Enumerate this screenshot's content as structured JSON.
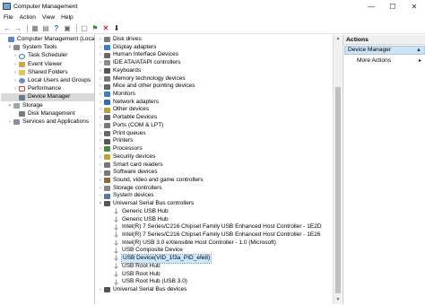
{
  "window": {
    "title": "Computer Management",
    "controls": [
      "—",
      "☐",
      "✕"
    ]
  },
  "menu": [
    "File",
    "Action",
    "View",
    "Help"
  ],
  "toolbar": [
    "←",
    "→",
    "▦",
    "▤",
    "?",
    "▣",
    "▢",
    "⚑",
    "✕",
    "⬇"
  ],
  "left_tree": [
    {
      "label": "Computer Management (Local",
      "indent": 0,
      "exp": "",
      "icon": "mgmt",
      "selected": false
    },
    {
      "label": "System Tools",
      "indent": 1,
      "exp": "˅",
      "icon": "tools",
      "selected": false
    },
    {
      "label": "Task Scheduler",
      "indent": 2,
      "exp": "›",
      "icon": "clock",
      "selected": false
    },
    {
      "label": "Event Viewer",
      "indent": 2,
      "exp": "›",
      "icon": "ev",
      "selected": false
    },
    {
      "label": "Shared Folders",
      "indent": 2,
      "exp": "›",
      "icon": "fold",
      "selected": false
    },
    {
      "label": "Local Users and Groups",
      "indent": 2,
      "exp": "›",
      "icon": "users",
      "selected": false
    },
    {
      "label": "Performance",
      "indent": 2,
      "exp": "›",
      "icon": "perf",
      "selected": false
    },
    {
      "label": "Device Manager",
      "indent": 2,
      "exp": "",
      "icon": "dev",
      "selected": true
    },
    {
      "label": "Storage",
      "indent": 1,
      "exp": "˅",
      "icon": "stor",
      "selected": false
    },
    {
      "label": "Disk Management",
      "indent": 2,
      "exp": "",
      "icon": "disk",
      "selected": false
    },
    {
      "label": "Services and Applications",
      "indent": 1,
      "exp": "›",
      "icon": "svc",
      "selected": false
    }
  ],
  "device_tree": [
    {
      "label": "Disk drives",
      "indent": 0,
      "exp": "›",
      "icon": "#7c7c7c"
    },
    {
      "label": "Display adapters",
      "indent": 0,
      "exp": "›",
      "icon": "#3b7fc4"
    },
    {
      "label": "Human Interface Devices",
      "indent": 0,
      "exp": "›",
      "icon": "#6a6a6a"
    },
    {
      "label": "IDE ATA/ATAPI controllers",
      "indent": 0,
      "exp": "›",
      "icon": "#8a8a8a"
    },
    {
      "label": "Keyboards",
      "indent": 0,
      "exp": "›",
      "icon": "#555"
    },
    {
      "label": "Memory technology devices",
      "indent": 0,
      "exp": "›",
      "icon": "#777"
    },
    {
      "label": "Mice and other pointing devices",
      "indent": 0,
      "exp": "›",
      "icon": "#666"
    },
    {
      "label": "Monitors",
      "indent": 0,
      "exp": "›",
      "icon": "#3b7fc4"
    },
    {
      "label": "Network adapters",
      "indent": 0,
      "exp": "›",
      "icon": "#2e6db3"
    },
    {
      "label": "Other devices",
      "indent": 0,
      "exp": "›",
      "icon": "#b8a040"
    },
    {
      "label": "Portable Devices",
      "indent": 0,
      "exp": "›",
      "icon": "#666"
    },
    {
      "label": "Ports (COM & LPT)",
      "indent": 0,
      "exp": "›",
      "icon": "#777"
    },
    {
      "label": "Print queues",
      "indent": 0,
      "exp": "›",
      "icon": "#666"
    },
    {
      "label": "Printers",
      "indent": 0,
      "exp": "›",
      "icon": "#555"
    },
    {
      "label": "Processors",
      "indent": 0,
      "exp": "›",
      "icon": "#4a8a3a"
    },
    {
      "label": "Security devices",
      "indent": 0,
      "exp": "›",
      "icon": "#c0a030"
    },
    {
      "label": "Smart card readers",
      "indent": 0,
      "exp": "›",
      "icon": "#777"
    },
    {
      "label": "Software devices",
      "indent": 0,
      "exp": "›",
      "icon": "#777"
    },
    {
      "label": "Sound, video and game controllers",
      "indent": 0,
      "exp": "›",
      "icon": "#8a6a3a"
    },
    {
      "label": "Storage controllers",
      "indent": 0,
      "exp": "›",
      "icon": "#888"
    },
    {
      "label": "System devices",
      "indent": 0,
      "exp": "›",
      "icon": "#5a7aa0"
    },
    {
      "label": "Universal Serial Bus controllers",
      "indent": 0,
      "exp": "˅",
      "icon": "#555"
    },
    {
      "label": "Generic USB Hub",
      "indent": 1,
      "exp": "",
      "icon": "usb"
    },
    {
      "label": "Generic USB Hub",
      "indent": 1,
      "exp": "",
      "icon": "usb"
    },
    {
      "label": "Intel(R) 7 Series/C216 Chipset Family USB Enhanced Host Controller - 1E2D",
      "indent": 1,
      "exp": "",
      "icon": "usb"
    },
    {
      "label": "Intel(R) 7 Series/C216 Chipset Family USB Enhanced Host Controller - 1E26",
      "indent": 1,
      "exp": "",
      "icon": "usb"
    },
    {
      "label": "Intel(R) USB 3.0 eXtensible Host Controller - 1.0 (Microsoft)",
      "indent": 1,
      "exp": "",
      "icon": "usb"
    },
    {
      "label": "USB Composite Device",
      "indent": 1,
      "exp": "",
      "icon": "usb"
    },
    {
      "label": "USB Device(VID_1f3a_PID_efe8)",
      "indent": 1,
      "exp": "",
      "icon": "usb",
      "selected": true
    },
    {
      "label": "USB Root Hub",
      "indent": 1,
      "exp": "",
      "icon": "usb"
    },
    {
      "label": "USB Root Hub",
      "indent": 1,
      "exp": "",
      "icon": "usb"
    },
    {
      "label": "USB Root Hub (USB 3.0)",
      "indent": 1,
      "exp": "",
      "icon": "usb"
    },
    {
      "label": "Universal Serial Bus devices",
      "indent": 0,
      "exp": "›",
      "icon": "#555"
    }
  ],
  "actions": {
    "header": "Actions",
    "selected": "Device Manager",
    "more": "More Actions"
  }
}
